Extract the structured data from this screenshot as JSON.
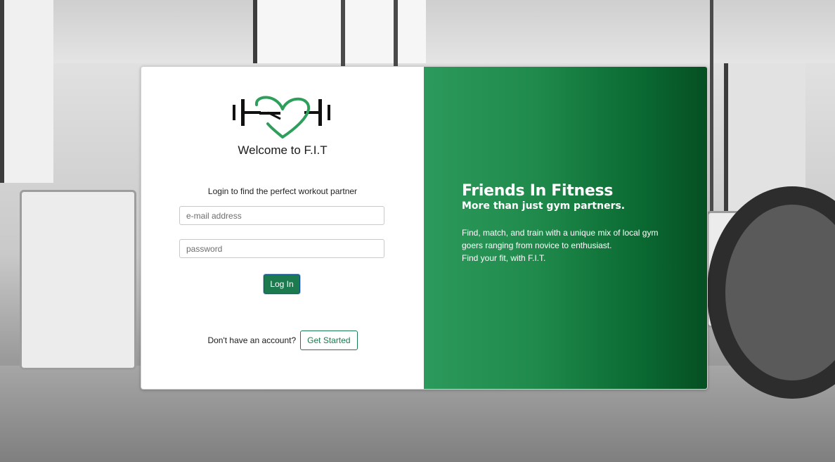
{
  "brand": {
    "logo_icon": "dumbbell-heart-icon",
    "welcome": "Welcome to F.I.T"
  },
  "login": {
    "subtitle": "Login to find the perfect workout partner",
    "email_placeholder": "e-mail address",
    "email_value": "",
    "password_placeholder": "password",
    "password_value": "",
    "login_label": "Log In"
  },
  "signup": {
    "prompt": "Don't have an account?",
    "button_label": "Get Started"
  },
  "hero": {
    "title": "Friends In Fitness",
    "subtitle": "More than just gym partners.",
    "body_lines": [
      "Find, match, and train with a unique mix of local gym",
      "goers ranging from novice to enthusiast.",
      "Find your fit, with F.I.T."
    ]
  },
  "colors": {
    "accent_green": "#1b7a4e",
    "logo_heart": "#2e9e5b",
    "hero_gradient_start": "#2c9a5c",
    "hero_gradient_end": "#064f22"
  }
}
